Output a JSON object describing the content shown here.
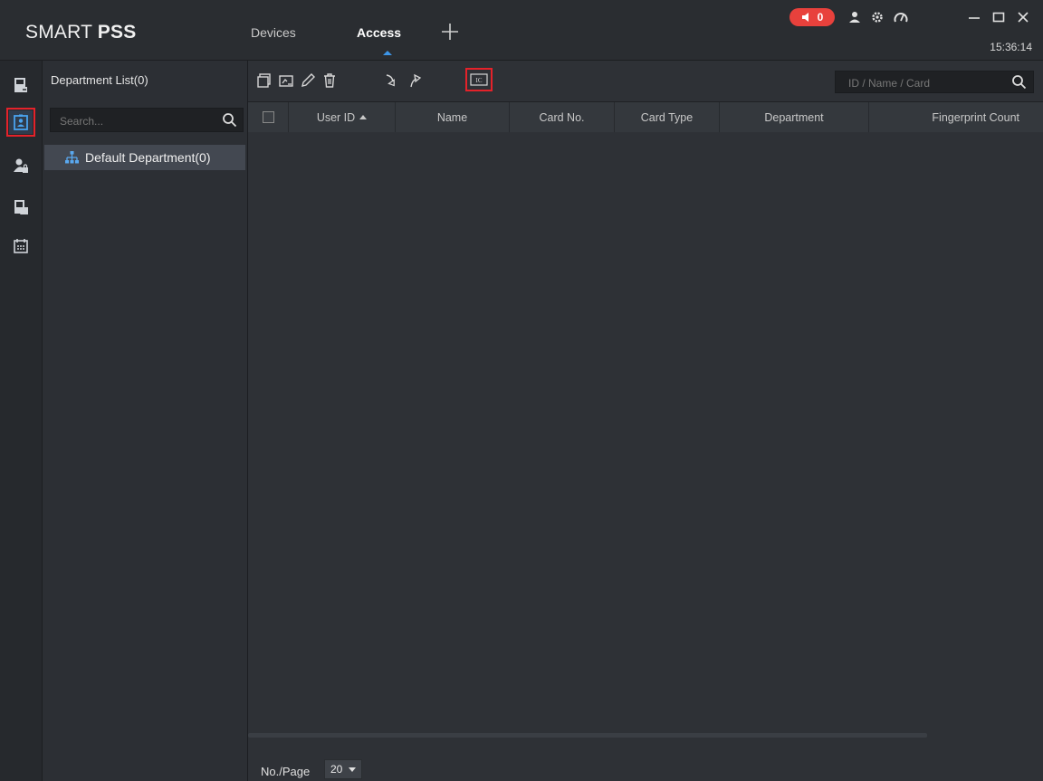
{
  "app": {
    "brand_light": "SMART ",
    "brand_bold": "PSS",
    "tabs": [
      {
        "label": "Devices"
      },
      {
        "label": "Access"
      }
    ],
    "alarm_count": "0",
    "clock": "15:36:14"
  },
  "department_panel": {
    "title": "Department List(0)",
    "search_placeholder": "Search...",
    "items": [
      {
        "label": "Default Department(0)"
      }
    ]
  },
  "toolbar": {
    "search_placeholder": "ID / Name / Card",
    "ic_label": "IC"
  },
  "table": {
    "columns": [
      "User ID",
      "Name",
      "Card No.",
      "Card Type",
      "Department",
      "Fingerprint Count"
    ],
    "rows": []
  },
  "footer": {
    "per_page_label": "No./Page",
    "per_page_value": "20"
  },
  "colors": {
    "accent_red": "#e4222a",
    "alarm_red": "#e8413c",
    "background": "#2e3136"
  }
}
